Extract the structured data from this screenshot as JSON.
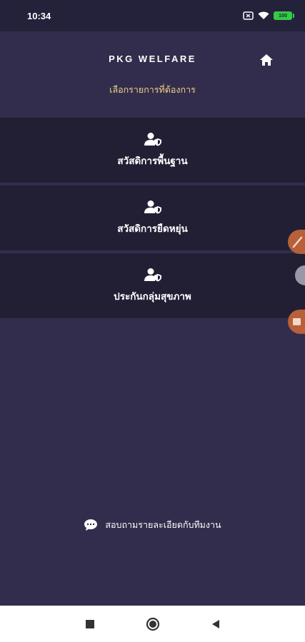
{
  "status_bar": {
    "time": "10:34",
    "battery": "100",
    "icons": [
      "notification-icon",
      "wifi-icon",
      "battery-icon"
    ]
  },
  "header": {
    "title": "PKG WELFARE",
    "subtitle": "เลือกรายการที่ต้องการ",
    "home_icon": "home-icon"
  },
  "menu": {
    "items": [
      {
        "label": "สวัสดิการพื้นฐาน",
        "icon": "user-shield-icon"
      },
      {
        "label": "สวัสดิการยืดหยุ่น",
        "icon": "user-shield-icon"
      },
      {
        "label": "ประกันกลุ่มสุขภาพ",
        "icon": "user-shield-icon"
      }
    ]
  },
  "footer": {
    "contact_label": "สอบถามรายละเอียดกับทีมงาน",
    "contact_icon": "chat-bubble-icon"
  },
  "navbar": {
    "buttons": [
      "recents-icon",
      "home-circle-icon",
      "back-icon"
    ]
  },
  "colors": {
    "background": "#322d4c",
    "menu_item": "#221f35",
    "status_bar": "#24223a",
    "subtitle": "#f0d28a",
    "floating_tab": "#b7603a"
  }
}
